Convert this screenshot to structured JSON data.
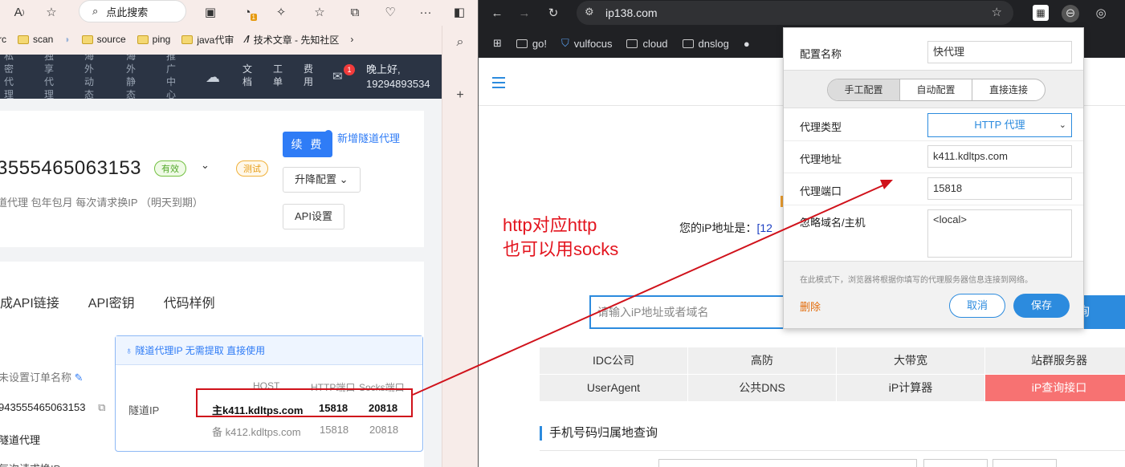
{
  "left_browser": {
    "search_placeholder": "点此搜索",
    "ext_badge": "1",
    "bookmarks": [
      "rc",
      "scan",
      "source",
      "ping",
      "java代审",
      "技术文章 - 先知社区"
    ],
    "nav": {
      "partial_items": [
        "私密代理",
        "独享代理",
        "海外动态",
        "海外静态",
        "推广中心"
      ],
      "items": [
        "文档",
        "工单",
        "费用"
      ],
      "mail_badge": "1",
      "greeting": "晚上好,",
      "user": "19294893534"
    },
    "order": {
      "number": "3555465063153",
      "status_tag": "有效",
      "test_tag": "测试",
      "sub_info": "道代理  包年包月  每次请求换IP  （明天到期）",
      "renew_label": "续 费",
      "add_tunnel_link": "新增隧道代理",
      "upgrade_label": "升降配置",
      "api_settings_label": "API设置"
    },
    "detail": {
      "tabs": [
        "成API链接",
        "API密钥",
        "代码样例"
      ],
      "unnamed_label": "未设置订单名称",
      "order_id": "943555465063153",
      "product": "隧道代理",
      "cut_row": "每次请求换IP",
      "tunnel_tip": "隧道代理IP 无需提取 直接使用",
      "columns": [
        "HOST",
        "HTTP端口",
        "Socks端口"
      ],
      "row_label": "隧道IP",
      "main": {
        "prefix": "主",
        "host": "k411.kdltps.com",
        "http": "15818",
        "socks": "20818"
      },
      "backup": {
        "prefix": "备",
        "host": "k412.kdltps.com",
        "http": "15818",
        "socks": "20818"
      }
    }
  },
  "right_browser": {
    "url": "ip138.com",
    "bookmarks": [
      "go!",
      "vulfocus",
      "cloud",
      "dnslog"
    ],
    "page": {
      "annotation_line1": "http对应http",
      "annotation_line2": "也可以用socks",
      "ip_label": "您的iP地址是：",
      "ip_value": "[12",
      "input_placeholder": "请输入iP地址或者域名",
      "query_button": "询",
      "grid": [
        [
          "IDC公司",
          "高防",
          "大带宽",
          "站群服务器"
        ],
        [
          "UserAgent",
          "公共DNS",
          "iP计算器",
          "iP查询接口"
        ]
      ],
      "phone_title": "手机号码归属地查询"
    },
    "proxy_popup": {
      "config_name_label": "配置名称",
      "config_name_value": "快代理",
      "modes": [
        "手工配置",
        "自动配置",
        "直接连接"
      ],
      "active_mode": "手工配置",
      "type_label": "代理类型",
      "type_value": "HTTP 代理",
      "address_label": "代理地址",
      "address_value": "k411.kdltps.com",
      "port_label": "代理端口",
      "port_value": "15818",
      "bypass_label": "忽略域名/主机",
      "bypass_value": "<local>",
      "note": "在此模式下，浏览器将根据你填写的代理服务器信息连接到网络。",
      "delete_label": "删除",
      "cancel_label": "取消",
      "save_label": "保存"
    }
  },
  "colors": {
    "accent_blue": "#2c8bde",
    "annotation_red": "#e3141e",
    "nav_dark": "#2b3444",
    "highlight_cell": "#f77272"
  }
}
